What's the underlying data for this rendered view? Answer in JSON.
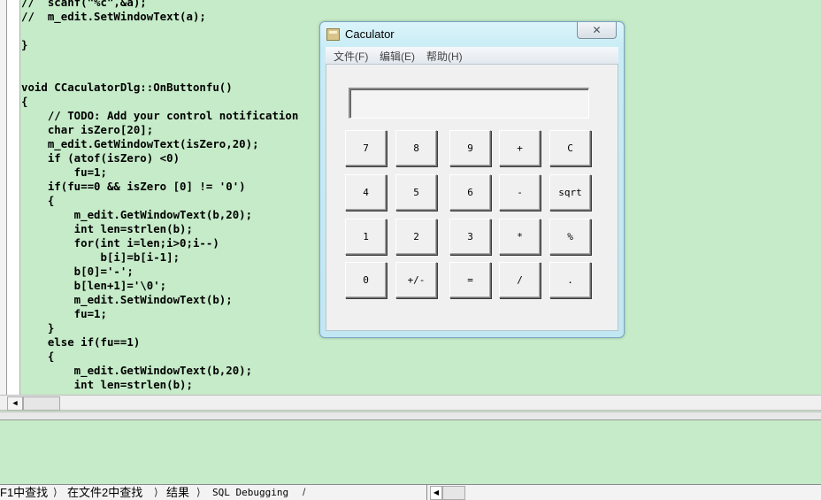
{
  "editor": {
    "code_lines": [
      "//  scanf(\"%c\",&a);",
      "//  m_edit.SetWindowText(a);",
      "",
      "}",
      "",
      "",
      "void CCaculatorDlg::OnButtonfu()",
      "{",
      "    // TODO: Add your control notification",
      "    char isZero[20];",
      "    m_edit.GetWindowText(isZero,20);",
      "    if (atof(isZero) <0)",
      "        fu=1;",
      "    if(fu==0 && isZero [0] != '0')",
      "    {",
      "        m_edit.GetWindowText(b,20);",
      "        int len=strlen(b);",
      "        for(int i=len;i>0;i--)",
      "            b[i]=b[i-1];",
      "        b[0]='-';",
      "        b[len+1]='\\0';",
      "        m_edit.SetWindowText(b);",
      "        fu=1;",
      "    }",
      "    else if(fu==1)",
      "    {",
      "        m_edit.GetWindowText(b,20);",
      "        int len=strlen(b);"
    ]
  },
  "scroll": {
    "left_arrow": "◀"
  },
  "tabs": [
    {
      "label": "F1中查找"
    },
    {
      "label": "在文件2中查找"
    },
    {
      "label": "结果"
    },
    {
      "label": "SQL Debugging"
    }
  ],
  "tab_separator": "⟩",
  "tab_end_separator": "/",
  "calculator": {
    "title": "Caculator",
    "close_glyph": "✕",
    "menu": [
      "文件(F)",
      "编辑(E)",
      "帮助(H)"
    ],
    "display_value": "",
    "buttons": [
      [
        "7",
        "8",
        "9",
        "+",
        "C"
      ],
      [
        "4",
        "5",
        "6",
        "-",
        "sqrt"
      ],
      [
        "1",
        "2",
        "3",
        "*",
        "%"
      ],
      [
        "0",
        "+/-",
        "=",
        "/",
        "."
      ]
    ]
  },
  "colors": {
    "editor_background": "#c6ebc9",
    "window_frame": "#c1e7f2",
    "dialog_face": "#f0f0f0"
  },
  "icons": {
    "app_icon": "calculator-app-icon",
    "close": "close-icon"
  }
}
